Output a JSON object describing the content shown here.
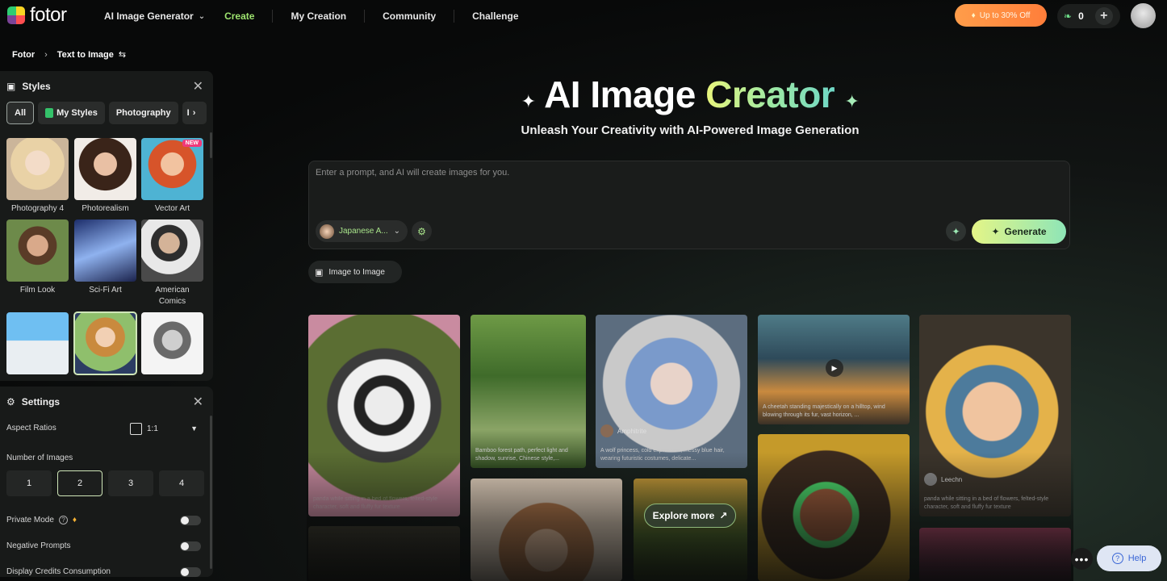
{
  "header": {
    "logo_text": "fotor",
    "nav": [
      {
        "label": "AI Image Generator",
        "has_dropdown": true,
        "active": false
      },
      {
        "label": "Create",
        "active": true
      },
      {
        "label": "My Creation",
        "active": false
      },
      {
        "label": "Community",
        "active": false
      },
      {
        "label": "Challenge",
        "active": false
      }
    ],
    "promo_label": "Up to 30% Off",
    "credits_count": "0"
  },
  "breadcrumb": {
    "root": "Fotor",
    "current": "Text to Image"
  },
  "styles_panel": {
    "title": "Styles",
    "chips": [
      "All",
      "My Styles",
      "Photography",
      "I"
    ],
    "new_badge": "NEW",
    "items": [
      {
        "label": "Photography 4"
      },
      {
        "label": "Photorealism"
      },
      {
        "label": "Vector Art"
      },
      {
        "label": "Film Look"
      },
      {
        "label": "Sci-Fi Art"
      },
      {
        "label": "American Comics"
      }
    ]
  },
  "settings_panel": {
    "title": "Settings",
    "aspect_label": "Aspect Ratios",
    "aspect_value": "1:1",
    "num_images_label": "Number of Images",
    "num_options": [
      "1",
      "2",
      "3",
      "4"
    ],
    "selected_num": "2",
    "private_mode_label": "Private Mode",
    "negative_prompts_label": "Negative Prompts",
    "display_credits_label": "Display Credits Consumption"
  },
  "hero": {
    "title_part1": "AI Image",
    "title_part2": "Creator",
    "subtitle": "Unleash Your Creativity with AI-Powered Image Generation",
    "prompt_placeholder": "Enter a prompt, and AI will create images for you.",
    "style_selected": "Japanese A...",
    "generate_label": "Generate",
    "img2img_label": "Image to Image"
  },
  "gallery": {
    "captions": {
      "bamboo": "Bamboo forest path, perfect light and shadow, sunrise, Chinese style,...",
      "wolf_girl": "A wolf princess, cold expression, messy blue hair, wearing futuristic costumes, delicate...",
      "cheetah": "A cheetah standing majestically on a hilltop, wind blowing through its fur, vast horizon, ...",
      "panda": "panda while sitting in a bed of flowers, felted-style character, soft and fluffy fur texture",
      "pearl": "panda while sitting in a bed of flowers, felted-style character, soft and fluffy fur texture"
    },
    "authors": {
      "wolf_girl": "Amphitrite",
      "pearl": "Leechn"
    },
    "explore_label": "Explore more"
  },
  "floating": {
    "help_label": "Help"
  },
  "colors": {
    "accent_green": "#9ee46f",
    "generate_gradient_start": "#e4f587",
    "generate_gradient_end": "#8ee5b7",
    "promo_orange": "#ff8a3d"
  }
}
